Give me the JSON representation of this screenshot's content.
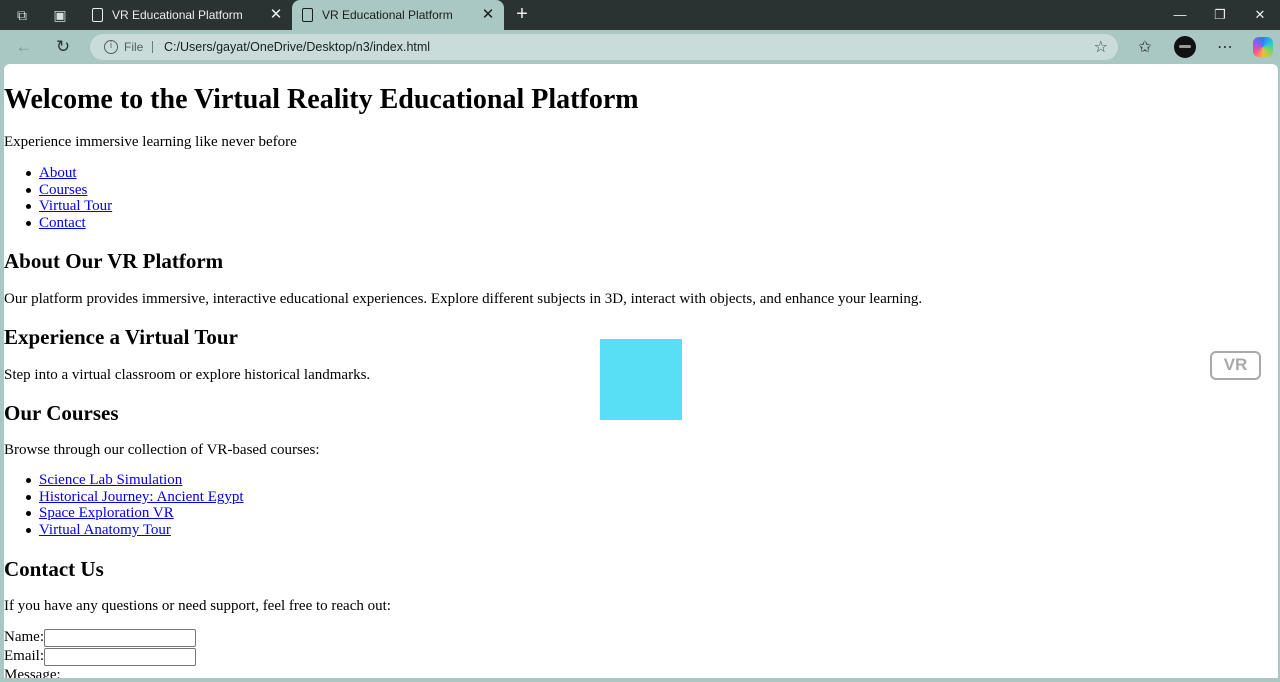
{
  "browser": {
    "tabs": [
      {
        "title": "VR Educational Platform",
        "active": false
      },
      {
        "title": "VR Educational Platform",
        "active": true
      }
    ],
    "address": {
      "scheme_label": "File",
      "url": "C:/Users/gayat/OneDrive/Desktop/n3/index.html"
    },
    "icons": {
      "workspaces": "workspaces-icon",
      "tab_actions": "vertical-tabs-icon",
      "back": "back-arrow-icon",
      "reload": "reload-icon",
      "favorite": "star-icon",
      "favorites": "favorites-icon",
      "more": "more-icon",
      "copilot": "copilot-icon"
    },
    "colors": {
      "frame": "#a9c7c3",
      "titlebar": "#2b3332"
    }
  },
  "page": {
    "heading": "Welcome to the Virtual Reality Educational Platform",
    "tagline": "Experience immersive learning like never before",
    "nav": [
      "About",
      "Courses",
      "Virtual Tour",
      "Contact"
    ],
    "about": {
      "heading": "About Our VR Platform",
      "text": "Our platform provides immersive, interactive educational experiences. Explore different subjects in 3D, interact with objects, and enhance your learning."
    },
    "tour": {
      "heading": "Experience a Virtual Tour",
      "text": "Step into a virtual classroom or explore historical landmarks.",
      "box_color": "#58def5",
      "badge": "VR"
    },
    "courses": {
      "heading": "Our Courses",
      "text": "Browse through our collection of VR-based courses:",
      "items": [
        "Science Lab Simulation",
        "Historical Journey: Ancient Egypt",
        "Space Exploration VR",
        "Virtual Anatomy Tour"
      ]
    },
    "contact": {
      "heading": "Contact Us",
      "text": "If you have any questions or need support, feel free to reach out:",
      "name_label": "Name:",
      "name_value": "",
      "email_label": "Email:",
      "email_value": "",
      "message_label": "Message:"
    }
  }
}
